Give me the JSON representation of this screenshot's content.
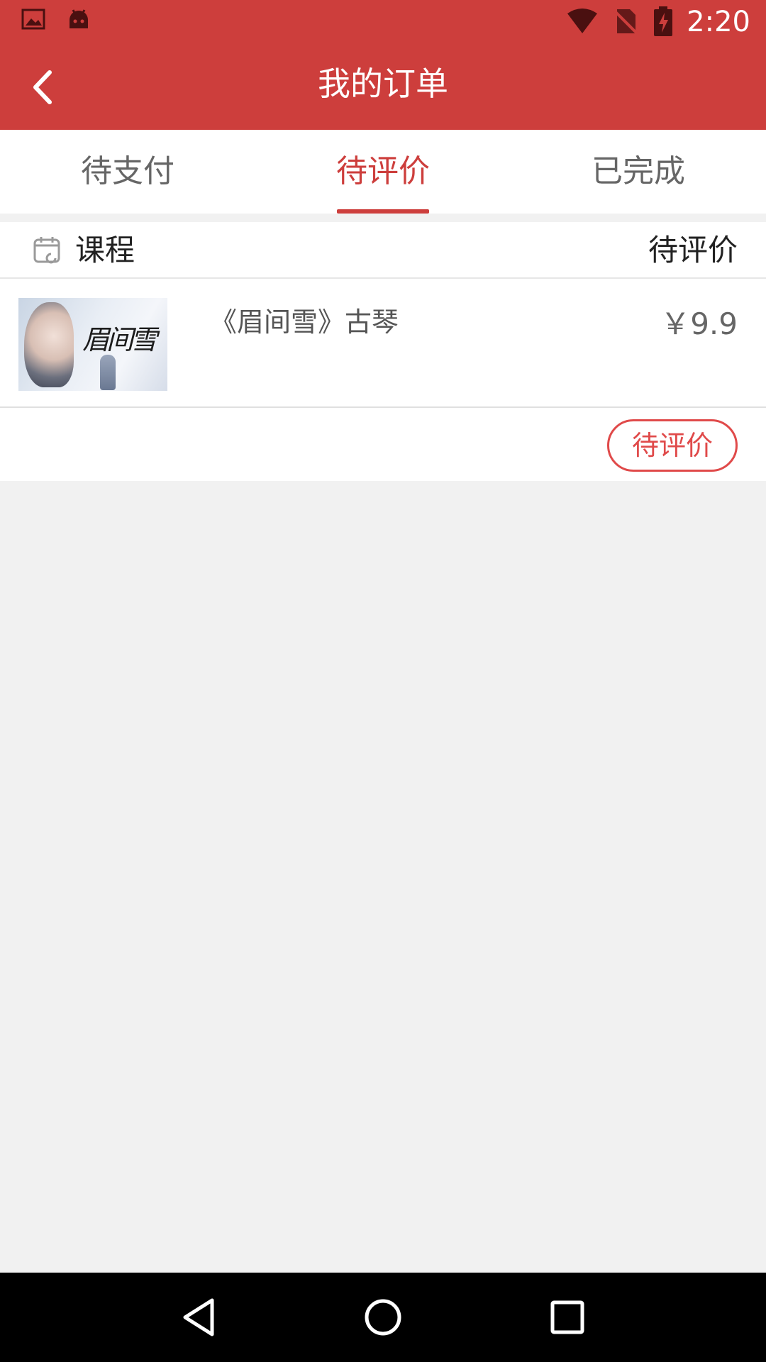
{
  "status_bar": {
    "time": "2:20",
    "left_icons": [
      "image-icon",
      "android-icon"
    ],
    "right_icons": [
      "wifi-icon",
      "no-sim-icon",
      "battery-charging-icon"
    ]
  },
  "app_bar": {
    "title": "我的订单",
    "back_icon": "chevron-left-icon"
  },
  "tabs": [
    {
      "label": "待支付",
      "active": false
    },
    {
      "label": "待评价",
      "active": true
    },
    {
      "label": "已完成",
      "active": false
    }
  ],
  "order": {
    "type_label": "课程",
    "type_icon": "calendar-icon",
    "status_label": "待评价",
    "item": {
      "name": "《眉间雪》古琴",
      "price": "￥9.9",
      "thumbnail_text": "眉间雪"
    },
    "action_button": "待评价"
  },
  "nav_bar": {
    "icons": [
      "back-triangle-icon",
      "home-circle-icon",
      "recents-square-icon"
    ]
  },
  "colors": {
    "primary": "#cd3e3c",
    "accent_button": "#e04a4a",
    "background": "#f1f1f1"
  }
}
